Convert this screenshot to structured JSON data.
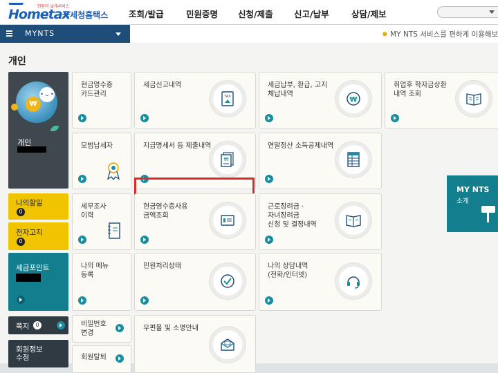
{
  "header": {
    "logo_small": "민원의 날개서비스",
    "logo_main": "Hometax",
    "logo_kr": "국세청홈택스",
    "menu": [
      "조회/발급",
      "민원증명",
      "신청/제출",
      "신고/납부",
      "상담/제보"
    ]
  },
  "nav": {
    "title": "MYNTS",
    "ticker": "MY NTS 서비스를 편하게 이용해보세"
  },
  "page_title": "개인",
  "profile": {
    "name": "개인"
  },
  "side": {
    "todo": "나의할일",
    "todo_count": "0",
    "bill": "전자고지",
    "bill_count": "0",
    "points": "세금포인트",
    "note": "쪽지",
    "note_count": "0",
    "member": "회원정보 수정"
  },
  "tiles": {
    "cash_receipt": "현금영수증\n카드관리",
    "tax_return": "세금신고내역",
    "payment": "세금납부, 환급, 고지\n체납내역",
    "student_loan": "취업후 학자금상환\n내역 조회",
    "model_taxpayer": "모범납세자",
    "statement": "지급명세서 등 제출내역",
    "yearend": "연말정산 소득공제내역",
    "tax_audit": "세무조사\n이력",
    "cash_receipt_amount": "현금영수증사용\n금액조회",
    "incentive": "근로장려금 ·\n자녀장려금\n신청 및 결정내역",
    "my_menu": "나의 메뉴\n등록",
    "civil_status": "민원처리상태",
    "consult": "나의 상담내역\n(전화/인터넷)",
    "password": "비밀번호\n변경",
    "mail": "우편물 및 소명안내",
    "withdraw": "회원탈퇴"
  },
  "mynts_card": {
    "title": "MY NTS",
    "sub": "소개"
  },
  "colors": {
    "brand": "#1d5fb5",
    "nav": "#1f4d7a",
    "teal": "#127e8e",
    "yellow": "#f1c400",
    "highlight": "#e2262a"
  }
}
